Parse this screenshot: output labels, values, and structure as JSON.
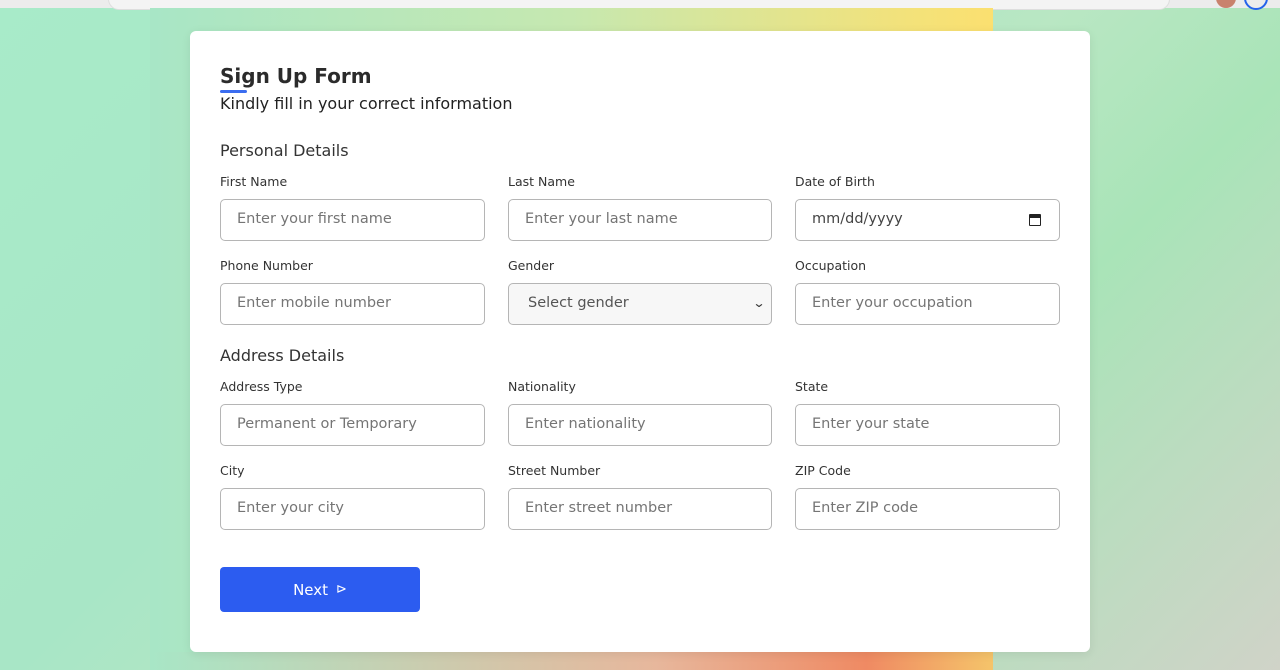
{
  "form": {
    "title": "Sign Up Form",
    "subtitle": "Kindly fill in your correct information",
    "accent_color": "#2c5cf0"
  },
  "sections": {
    "personal": {
      "title": "Personal Details",
      "fields": {
        "first_name": {
          "label": "First Name",
          "placeholder": "Enter your first name"
        },
        "last_name": {
          "label": "Last Name",
          "placeholder": "Enter your last name"
        },
        "dob": {
          "label": "Date of Birth",
          "placeholder": "mm/dd/yyyy",
          "icon": "calendar-icon"
        },
        "phone": {
          "label": "Phone Number",
          "placeholder": "Enter mobile number"
        },
        "gender": {
          "label": "Gender",
          "selected": "Select gender",
          "icon": "chevron-down-icon"
        },
        "occupation": {
          "label": "Occupation",
          "placeholder": "Enter your occupation"
        }
      }
    },
    "address": {
      "title": "Address Details",
      "fields": {
        "address_type": {
          "label": "Address Type",
          "placeholder": "Permanent or Temporary"
        },
        "nationality": {
          "label": "Nationality",
          "placeholder": "Enter nationality"
        },
        "state": {
          "label": "State",
          "placeholder": "Enter your state"
        },
        "city": {
          "label": "City",
          "placeholder": "Enter your city"
        },
        "street_number": {
          "label": "Street Number",
          "placeholder": "Enter street number"
        },
        "zip": {
          "label": "ZIP Code",
          "placeholder": "Enter ZIP code"
        }
      }
    }
  },
  "actions": {
    "next_label": "Next",
    "next_icon": "send-icon"
  }
}
